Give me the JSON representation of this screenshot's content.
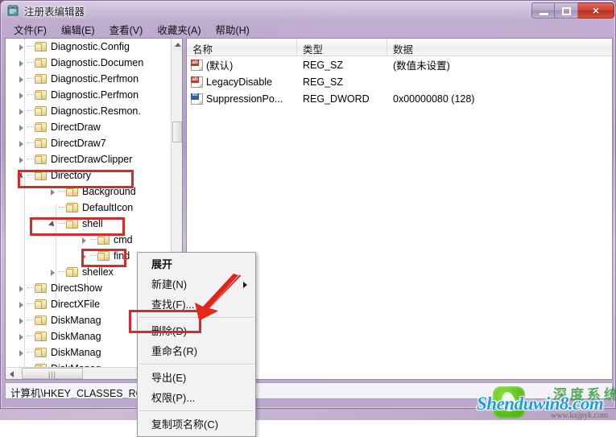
{
  "window": {
    "title": "注册表编辑器",
    "app_icon": "registry-editor-icon",
    "minimize_label": "最小化",
    "maximize_label": "最大化",
    "close_label": "×"
  },
  "menubar": {
    "items": [
      {
        "label": "文件(F)"
      },
      {
        "label": "编辑(E)"
      },
      {
        "label": "查看(V)"
      },
      {
        "label": "收藏夹(A)"
      },
      {
        "label": "帮助(H)"
      }
    ]
  },
  "tree": {
    "items": [
      {
        "label": "Diagnostic.Config",
        "indent": 1,
        "state": "collapsed"
      },
      {
        "label": "Diagnostic.Documen",
        "indent": 1,
        "state": "collapsed"
      },
      {
        "label": "Diagnostic.Perfmon",
        "indent": 1,
        "state": "collapsed"
      },
      {
        "label": "Diagnostic.Perfmon",
        "indent": 1,
        "state": "collapsed"
      },
      {
        "label": "Diagnostic.Resmon.",
        "indent": 1,
        "state": "collapsed"
      },
      {
        "label": "DirectDraw",
        "indent": 1,
        "state": "collapsed"
      },
      {
        "label": "DirectDraw7",
        "indent": 1,
        "state": "collapsed"
      },
      {
        "label": "DirectDrawClipper",
        "indent": 1,
        "state": "collapsed"
      },
      {
        "label": "Directory",
        "indent": 1,
        "state": "expanded"
      },
      {
        "label": "Background",
        "indent": 2,
        "state": "collapsed"
      },
      {
        "label": "DefaultIcon",
        "indent": 2,
        "state": "leaf"
      },
      {
        "label": "shell",
        "indent": 2,
        "state": "expanded"
      },
      {
        "label": "cmd",
        "indent": 3,
        "state": "collapsed"
      },
      {
        "label": "find",
        "indent": 3,
        "state": "collapsed"
      },
      {
        "label": "shellex",
        "indent": 2,
        "state": "collapsed"
      },
      {
        "label": "DirectShow",
        "indent": 1,
        "state": "collapsed"
      },
      {
        "label": "DirectXFile",
        "indent": 1,
        "state": "collapsed"
      },
      {
        "label": "DiskManag",
        "indent": 1,
        "state": "collapsed"
      },
      {
        "label": "DiskManag",
        "indent": 1,
        "state": "collapsed"
      },
      {
        "label": "DiskManag",
        "indent": 1,
        "state": "collapsed"
      },
      {
        "label": "DiskManag",
        "indent": 1,
        "state": "collapsed"
      }
    ],
    "vscroll": {
      "up_arrow": "scroll-up-icon"
    },
    "hscroll": {
      "left_arrow": "scroll-left-icon",
      "grip": "|||"
    }
  },
  "list": {
    "columns": [
      {
        "label": "名称"
      },
      {
        "label": "类型"
      },
      {
        "label": "数据"
      }
    ],
    "rows": [
      {
        "icon": "string-value-icon",
        "icon_kind": "sz",
        "icon_text": "ab",
        "name": "(默认)",
        "type": "REG_SZ",
        "data": "(数值未设置)"
      },
      {
        "icon": "string-value-icon",
        "icon_kind": "sz",
        "icon_text": "ab",
        "name": "LegacyDisable",
        "type": "REG_SZ",
        "data": ""
      },
      {
        "icon": "dword-value-icon",
        "icon_kind": "dword",
        "icon_text": "011",
        "name": "SuppressionPo...",
        "type": "REG_DWORD",
        "data": "0x00000080 (128)"
      }
    ]
  },
  "contextmenu": {
    "items": [
      {
        "label": "展开",
        "bold": true,
        "submenu": false,
        "sep_after": false
      },
      {
        "label": "新建(N)",
        "bold": false,
        "submenu": true,
        "sep_after": false
      },
      {
        "label": "查找(F)...",
        "bold": false,
        "submenu": false,
        "sep_after": true
      },
      {
        "label": "删除(D)",
        "bold": false,
        "submenu": false,
        "sep_after": false
      },
      {
        "label": "重命名(R)",
        "bold": false,
        "submenu": false,
        "sep_after": true
      },
      {
        "label": "导出(E)",
        "bold": false,
        "submenu": false,
        "sep_after": false
      },
      {
        "label": "权限(P)...",
        "bold": false,
        "submenu": false,
        "sep_after": true
      },
      {
        "label": "复制项名称(C)",
        "bold": false,
        "submenu": false,
        "sep_after": false
      }
    ]
  },
  "statusbar": {
    "text": "计算机\\HKEY_CLASSES_RO"
  },
  "annotations": {
    "highlight_color": "#d82a2a",
    "boxes": [
      {
        "name": "directory-highlight"
      },
      {
        "name": "shell-highlight"
      },
      {
        "name": "find-highlight"
      },
      {
        "name": "delete-menu-highlight"
      }
    ],
    "arrow": {
      "name": "delete-pointer-arrow"
    }
  },
  "watermark": {
    "text": "Shenduwin8.com",
    "subtext": "www.kxjpyk.com",
    "cn_text": "深度系统",
    "logo": "shenduwin-leaf-logo"
  }
}
